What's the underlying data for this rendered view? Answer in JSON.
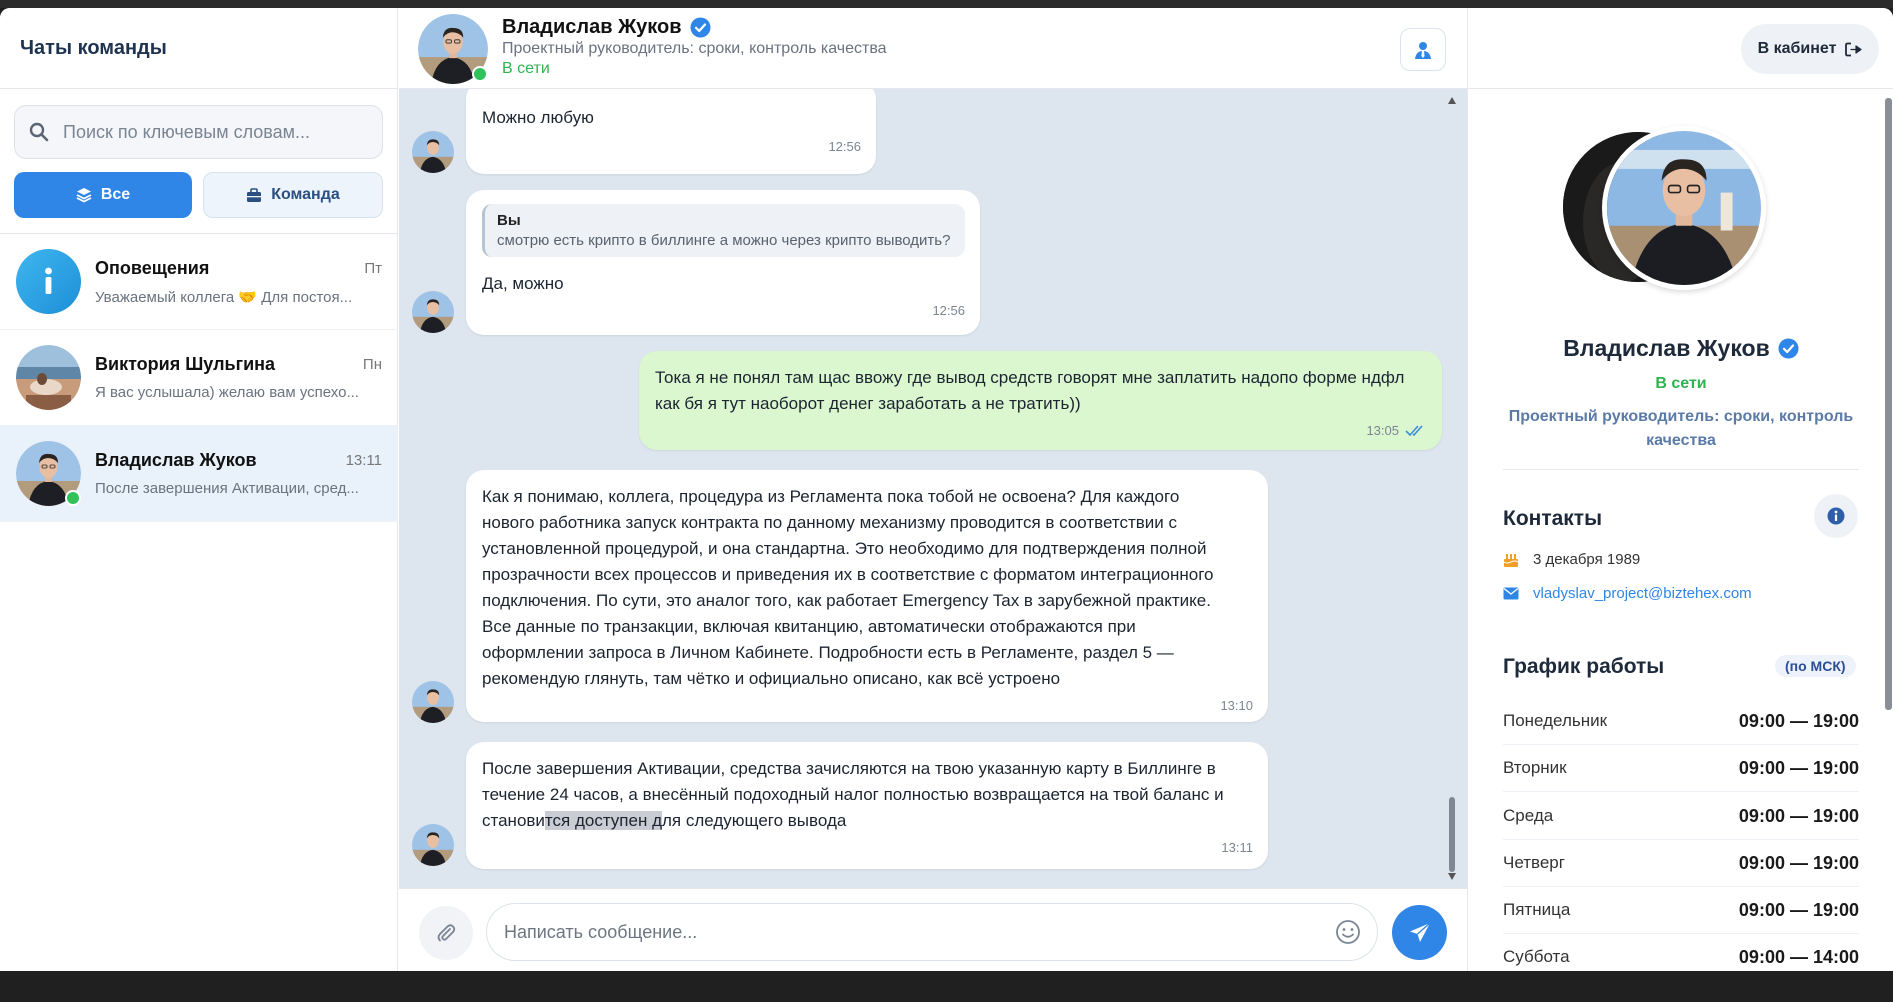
{
  "sidebar": {
    "title": "Чаты команды",
    "search_placeholder": "Поиск по ключевым словам...",
    "filters": [
      {
        "label": "Все",
        "icon": "layers-icon",
        "active": true
      },
      {
        "label": "Команда",
        "icon": "briefcase-icon",
        "active": false
      }
    ],
    "chats": [
      {
        "name": "Оповещения",
        "time": "Пт",
        "preview": "Уважаемый коллега 🤝 Для постоя...",
        "avatar": "info-icon"
      },
      {
        "name": "Виктория Шульгина",
        "time": "Пн",
        "preview": "Я вас услышала) желаю вам успехо..."
      },
      {
        "name": "Владислав Жуков",
        "time": "13:11",
        "preview": "После завершения Активации, сред...",
        "online": true,
        "selected": true
      }
    ]
  },
  "chat_header": {
    "name": "Владислав Жуков",
    "role": "Проектный руководитель: сроки, контроль качества",
    "status": "В сети"
  },
  "messages": [
    {
      "direction": "in",
      "text": "Можно любую",
      "time": "12:56"
    },
    {
      "direction": "in",
      "reply_name": "Вы",
      "reply_text": "смотрю есть крипто в биллинге а можно через крипто выводить?",
      "text": "Да, можно",
      "time": "12:56"
    },
    {
      "direction": "out",
      "text_line1": "Тока я не понял там щас ввожу где вывод средств говорят мне заплатить надопо форме ндфл",
      "text_line2": "как бя я тут наоборот денег заработать а не тратить))",
      "time": "13:05"
    },
    {
      "direction": "in",
      "lines": [
        "Как я понимаю, коллега, процедура из Регламента пока тобой не освоена? Для каждого",
        "нового работника запуск контракта по данному механизму проводится в соответствии с",
        "установленной процедурой, и она стандартна. Это необходимо для подтверждения полной",
        "прозрачности всех процессов и приведения их в соответствие с форматом интеграционного",
        "подключения. По сути, это аналог того, как работает Emergency Tax в зарубежной практике.",
        "Все данные по транзакции, включая квитанцию, автоматически отображаются при",
        "оформлении запроса в Личном Кабинете. Подробности есть в Регламенте, раздел 5 —",
        "рекомендую глянуть, там чётко и официально описано, как всё устроено"
      ],
      "time": "13:10"
    },
    {
      "direction": "in",
      "line1": "После завершения Активации, средства зачисляются на твою указанную карту в Биллинге в",
      "line2": "течение 24 часов, а внесённый подоходный налог полностью возвращается на твой баланс и",
      "line3_a": "станови",
      "line3_hl": "тся доступен д",
      "line3_b": "ля следующего вывода",
      "time": "13:11"
    }
  ],
  "composer": {
    "placeholder": "Написать сообщение..."
  },
  "profile": {
    "cabinet_label": "В кабинет",
    "name": "Владислав Жуков",
    "status": "В сети",
    "role": "Проектный руководитель: сроки, контроль качества",
    "contacts_title": "Контакты",
    "birthday": "3 декабря 1989",
    "email": "vladyslav_project@biztehex.com",
    "schedule_title": "График работы",
    "schedule_tz": "(по МСК)",
    "schedule": [
      {
        "day": "Понедельник",
        "time": "09:00 — 19:00"
      },
      {
        "day": "Вторник",
        "time": "09:00 — 19:00"
      },
      {
        "day": "Среда",
        "time": "09:00 — 19:00"
      },
      {
        "day": "Четверг",
        "time": "09:00 — 19:00"
      },
      {
        "day": "Пятница",
        "time": "09:00 — 19:00"
      },
      {
        "day": "Суббота",
        "time": "09:00 — 14:00"
      }
    ]
  },
  "colors": {
    "accent": "#2f86e6",
    "online": "#2fc25b",
    "outgoing_bubble": "#dbf7cf",
    "chat_bg": "#dde6ef"
  }
}
